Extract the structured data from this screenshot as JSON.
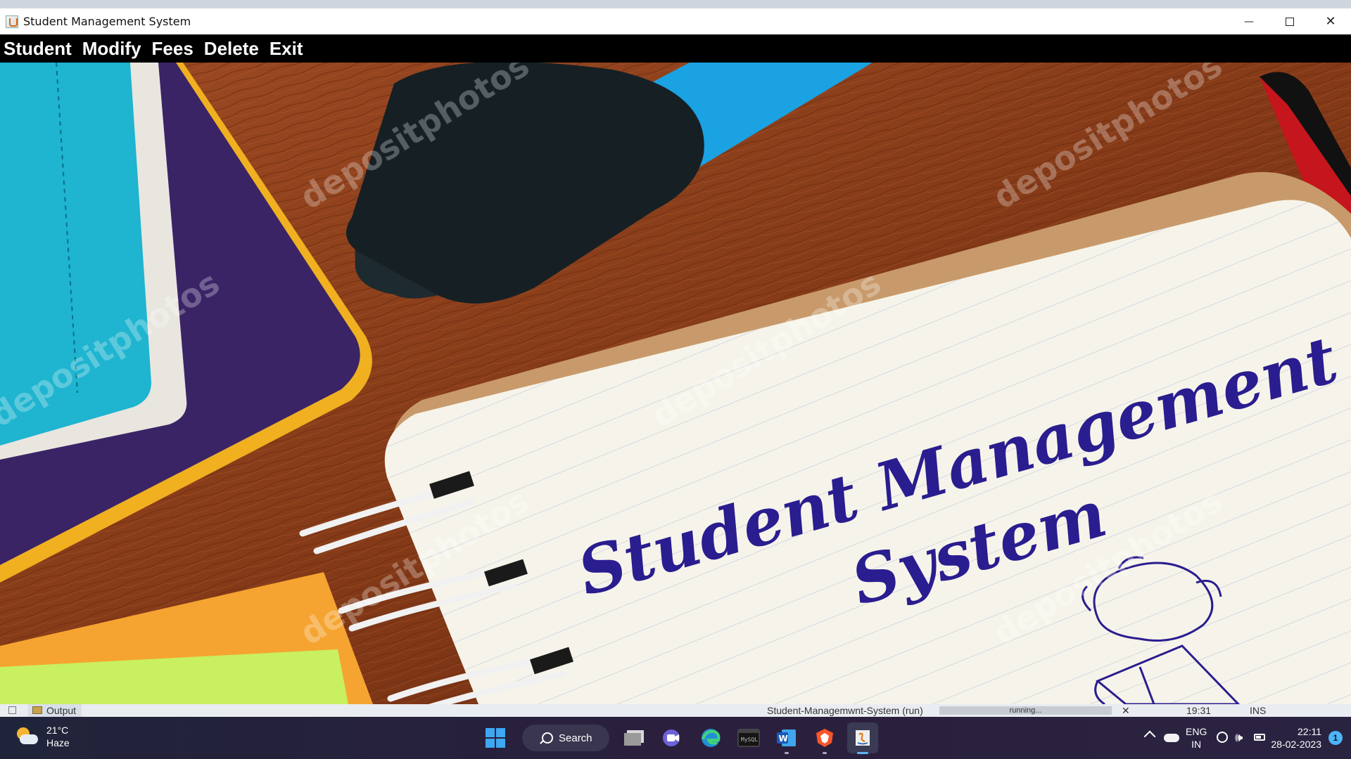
{
  "window": {
    "title": "Student Management System",
    "controls": {
      "minimize": "—",
      "close": "✕"
    }
  },
  "menu": {
    "items": [
      "Student",
      "Modify",
      "Fees",
      "Delete",
      "Exit"
    ]
  },
  "banner": {
    "line1": "Student Management",
    "line2": "System",
    "watermark": "depositphotos"
  },
  "ide_status": {
    "output_tab": "Output",
    "run_label": "Student-Managemwnt-System (run)",
    "progress_text": "running...",
    "close": "✕",
    "position": "19:31",
    "mode": "INS"
  },
  "taskbar": {
    "weather": {
      "temp": "21°C",
      "desc": "Haze"
    },
    "search_label": "Search",
    "apps": [
      "start-icon",
      "search",
      "task-view-icon",
      "meet-icon",
      "edge-icon",
      "terminal-icon",
      "word-icon",
      "brave-icon",
      "java-icon"
    ],
    "tray": {
      "lang": "ENG",
      "region": "IN",
      "time": "22:11",
      "date": "28-02-2023",
      "notification_count": "1"
    }
  },
  "colors": {
    "menubar": "#000000",
    "handwriting": "#2a1d8f",
    "table_wood": "#8b3f1c"
  }
}
